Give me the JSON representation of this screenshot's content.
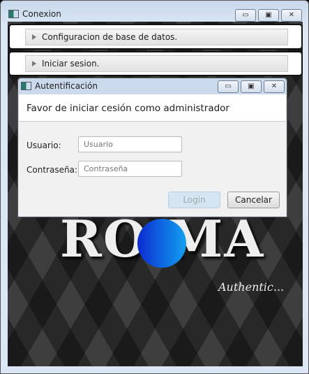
{
  "window": {
    "title": "Conexion",
    "min": "▭",
    "max": "▣",
    "close": "✕"
  },
  "accordion": [
    {
      "label": "Configuracion de base de datos."
    },
    {
      "label": "Iniciar sesion."
    }
  ],
  "background": {
    "logo_text": "RO MA",
    "tagline": "Authentic..."
  },
  "dialog": {
    "title": "Autentificación",
    "heading": "Favor de iniciar cesión como administrador",
    "user_label": "Usuario:",
    "user_placeholder": "Usuario",
    "user_value": "",
    "pass_label": "Contraseña:",
    "pass_placeholder": "Contraseña",
    "pass_value": "",
    "login": "Login",
    "cancel": "Cancelar"
  },
  "colors": {
    "login_disabled": "#d6e5f2",
    "accent": "#1260e0"
  }
}
